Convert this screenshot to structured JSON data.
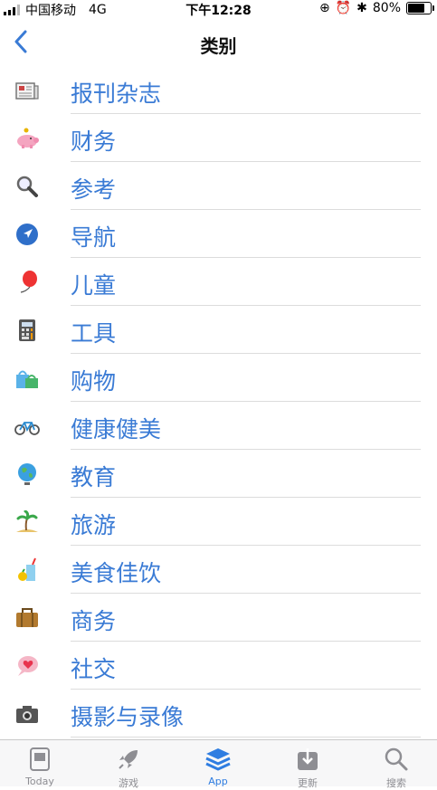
{
  "status_bar": {
    "carrier": "中国移动",
    "network": "4G",
    "time": "下午12:28",
    "battery": "80%",
    "battery_level": 0.8
  },
  "nav": {
    "title": "类别"
  },
  "categories": [
    {
      "label": "报刊杂志",
      "icon": "newspaper-icon"
    },
    {
      "label": "财务",
      "icon": "piggy-bank-icon"
    },
    {
      "label": "参考",
      "icon": "magnifier-icon"
    },
    {
      "label": "导航",
      "icon": "compass-icon"
    },
    {
      "label": "儿童",
      "icon": "balloon-icon"
    },
    {
      "label": "工具",
      "icon": "calculator-icon"
    },
    {
      "label": "购物",
      "icon": "shopping-bag-icon"
    },
    {
      "label": "健康健美",
      "icon": "bicycle-icon"
    },
    {
      "label": "教育",
      "icon": "globe-icon"
    },
    {
      "label": "旅游",
      "icon": "palm-island-icon"
    },
    {
      "label": "美食佳饮",
      "icon": "drink-icon"
    },
    {
      "label": "商务",
      "icon": "briefcase-icon"
    },
    {
      "label": "社交",
      "icon": "chat-heart-icon"
    },
    {
      "label": "摄影与录像",
      "icon": "camera-icon"
    }
  ],
  "tabbar": {
    "tabs": [
      {
        "label": "Today",
        "icon": "today-icon"
      },
      {
        "label": "游戏",
        "icon": "rocket-icon"
      },
      {
        "label": "App",
        "icon": "app-stack-icon"
      },
      {
        "label": "更新",
        "icon": "update-icon"
      },
      {
        "label": "搜索",
        "icon": "search-icon"
      }
    ],
    "active": "App"
  },
  "colors": {
    "accent": "#3a7bd5",
    "separator": "#dcdcdc",
    "tab_inactive": "#8e8e93"
  }
}
